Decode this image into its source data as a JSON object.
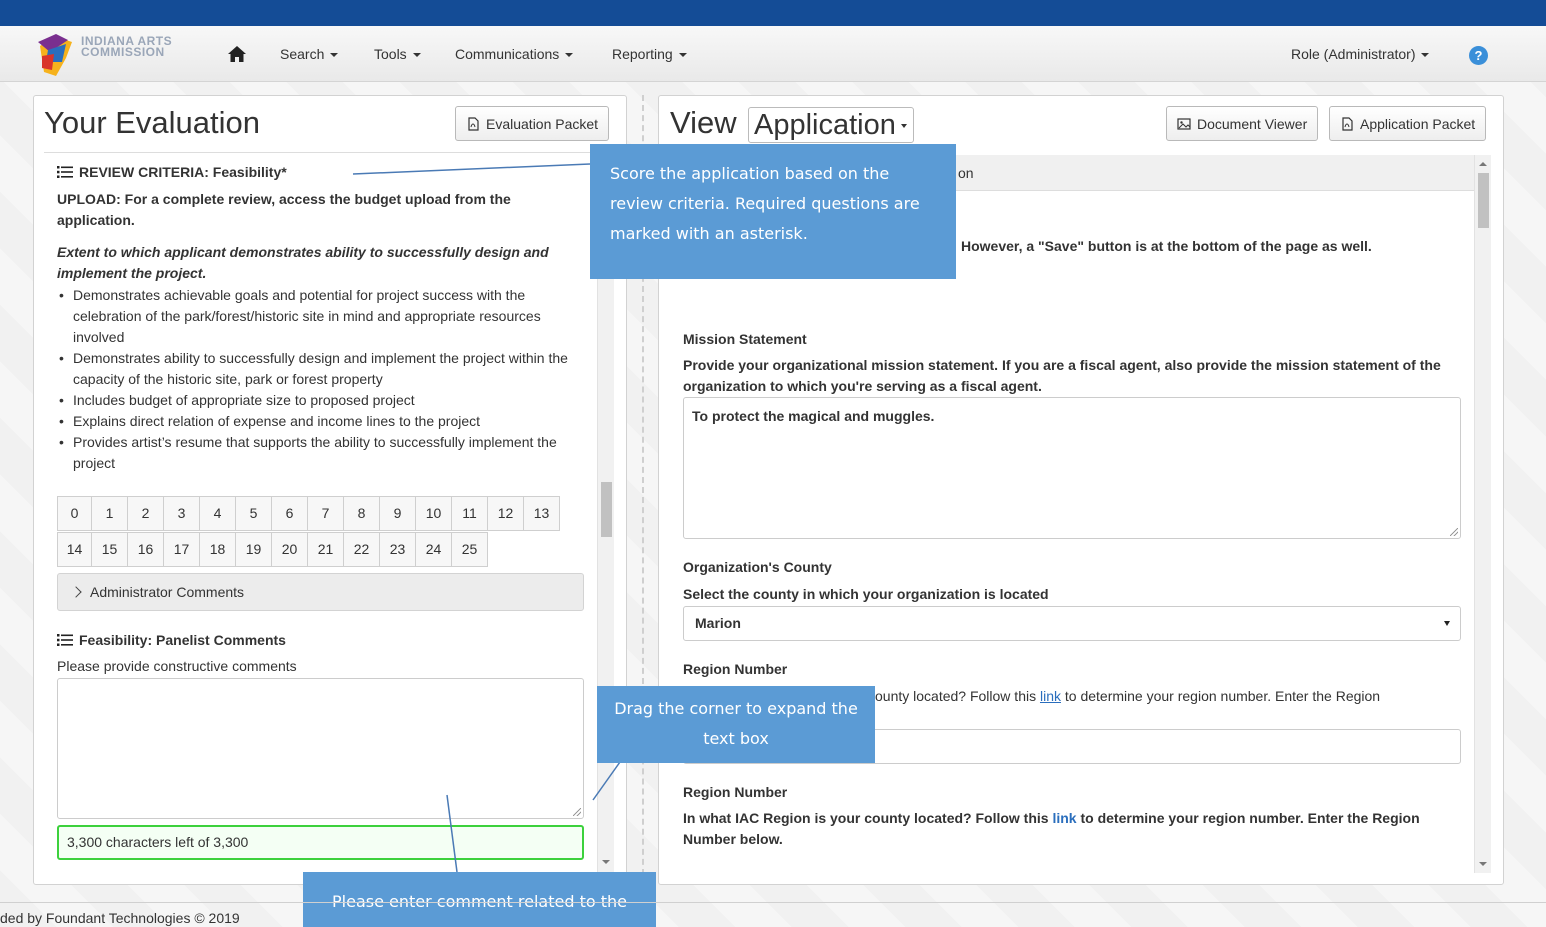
{
  "nav": {
    "brand_line1": "INDIANA ARTS",
    "brand_line2": "COMMISSION",
    "menu": [
      "Search",
      "Tools",
      "Communications",
      "Reporting"
    ],
    "role": "Role (Administrator)",
    "help": "?"
  },
  "left": {
    "title": "Your Evaluation",
    "packet_button": "Evaluation Packet",
    "criteria_heading": "REVIEW CRITERIA: Feasibility*",
    "upload_note": "UPLOAD: For a complete review, access the budget upload from the application.",
    "extent": "Extent to which applicant demonstrates ability to successfully design and implement the project.",
    "bullets": [
      "Demonstrates achievable goals and potential for project success with the celebration of the park/forest/historic site in mind and appropriate resources involved",
      "Demonstrates ability to successfully design and implement the project within the capacity of the historic site, park or forest property",
      "Includes budget of appropriate size to proposed project",
      "Explains direct relation of expense and income lines to the project",
      "Provides artist’s resume that supports the ability to successfully implement the project"
    ],
    "scores": [
      "0",
      "1",
      "2",
      "3",
      "4",
      "5",
      "6",
      "7",
      "8",
      "9",
      "10",
      "11",
      "12",
      "13",
      "14",
      "15",
      "16",
      "17",
      "18",
      "19",
      "20",
      "21",
      "22",
      "23",
      "24",
      "25"
    ],
    "admin_comments": "Administrator Comments",
    "panelist_heading": "Feasibility: Panelist Comments",
    "panelist_prompt": "Please provide constructive comments",
    "comment_value": "",
    "char_count": "3,300 characters left of 3,300"
  },
  "right": {
    "view_label": "View",
    "view_select": "Application",
    "doc_viewer_button": "Document Viewer",
    "app_packet_button": "Application Packet",
    "header_fragment": "on",
    "save_note": "However, a \"Save\" button is at the bottom of the page as well.",
    "mission_label": "Mission Statement",
    "mission_prompt": "Provide your organizational mission statement. If you are a fiscal agent, also provide the mission statement of the organization to which you're serving as a fiscal agent.",
    "mission_value": "To protect the magical and muggles.",
    "county_label": "Organization's County",
    "county_prompt": "Select the county in which your organization is located",
    "county_value": "Marion",
    "region1_label": "Region Number",
    "region1_prompt_pre": "ounty located? Follow this ",
    "region1_link": "link",
    "region1_prompt_post": " to determine your region number. Enter the Region",
    "region1_value": "",
    "region2_label": "Region Number",
    "region2_prompt_pre": "In what IAC Region is your county located? Follow this ",
    "region2_link": "link",
    "region2_prompt_post": " to determine your region number. Enter the Region Number below."
  },
  "callouts": {
    "criteria": "Score the application based on the review criteria. Required questions are marked with an asterisk.",
    "drag": "Drag the corner to expand the text box",
    "comment": "Please enter comment related to the"
  },
  "footer": {
    "text": "ded by Foundant Technologies © 2019"
  },
  "colors": {
    "topbar": "#144c96",
    "callout": "#5b9bd5",
    "valid_border": "#3cd13c",
    "link": "#2a6ebd"
  }
}
